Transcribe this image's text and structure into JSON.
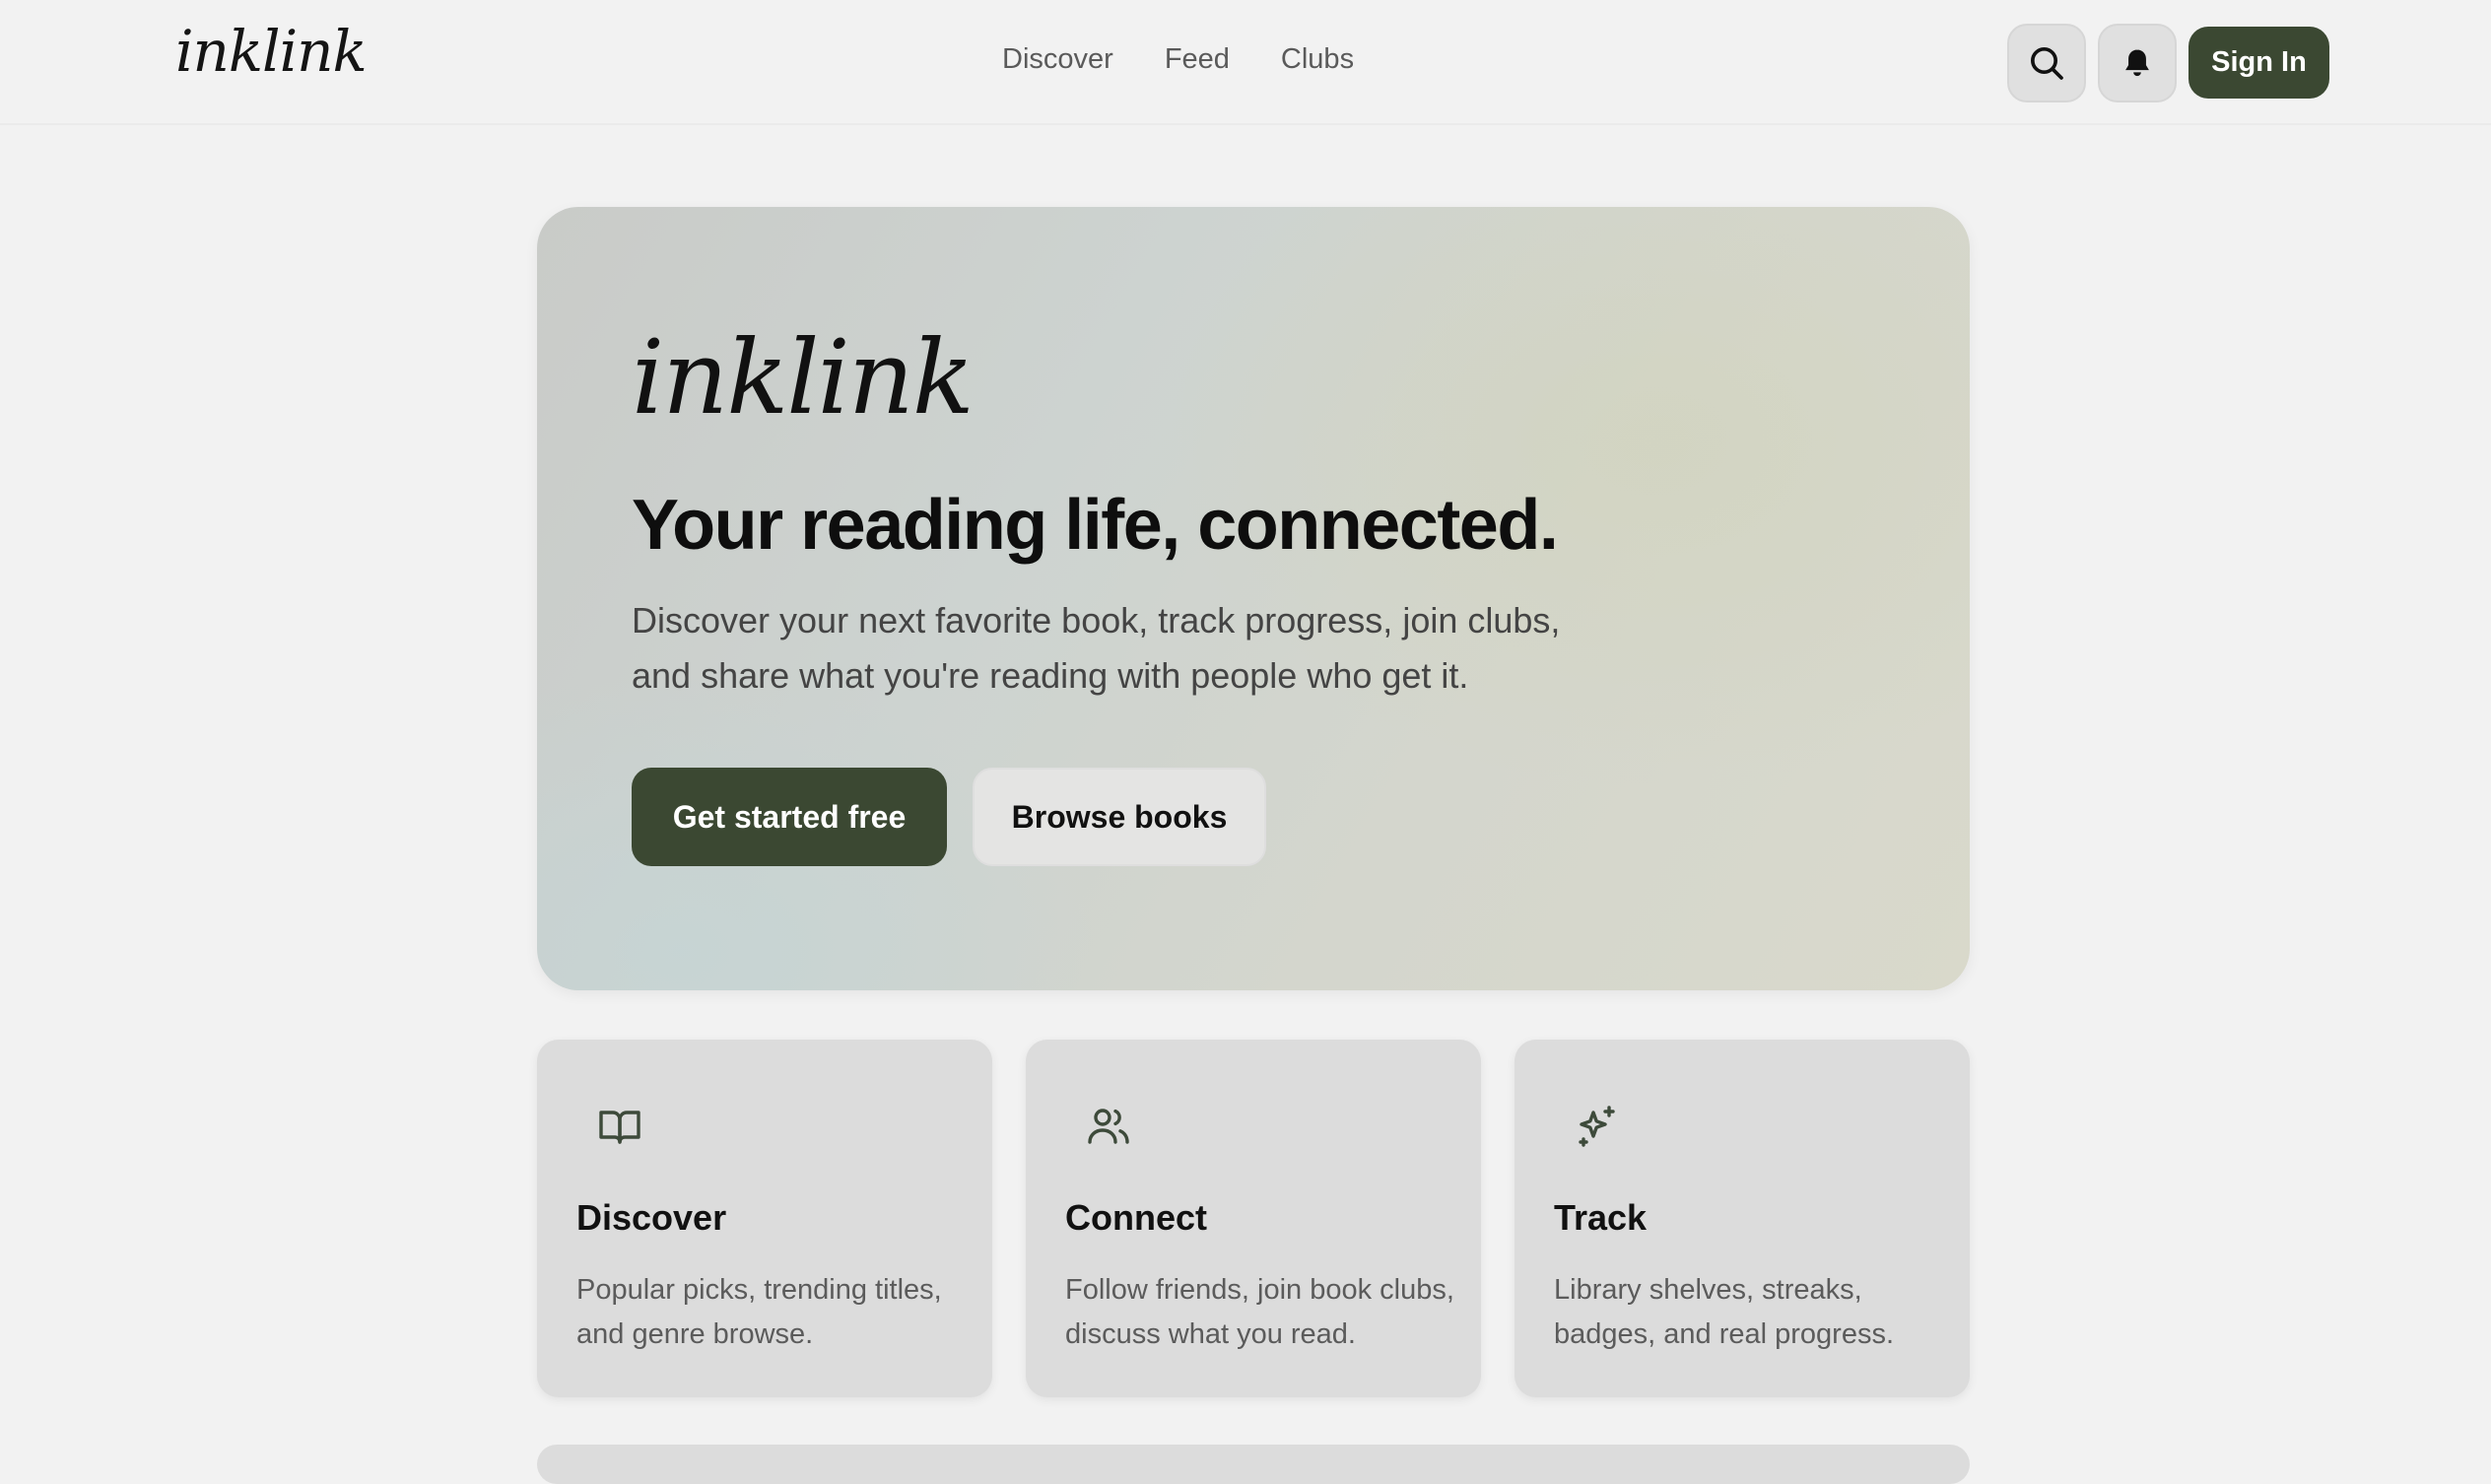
{
  "header": {
    "logo": "inklink",
    "nav": [
      "Discover",
      "Feed",
      "Clubs"
    ],
    "sign_in": "Sign In"
  },
  "hero": {
    "logo": "inklink",
    "title": "Your reading life, connected.",
    "subtitle_line1": "Discover your next favorite book, track progress, join clubs,",
    "subtitle_line2": "and share what you're reading with people who get it.",
    "primary_cta": "Get started free",
    "secondary_cta": "Browse books"
  },
  "features": [
    {
      "icon": "open-book-icon",
      "title": "Discover",
      "desc_line1": "Popular picks, trending titles,",
      "desc_line2": "and genre browse."
    },
    {
      "icon": "users-icon",
      "title": "Connect",
      "desc_line1": "Follow friends, join book clubs,",
      "desc_line2": "discuss what you read."
    },
    {
      "icon": "sparkles-icon",
      "title": "Track",
      "desc_line1": "Library shelves, streaks,",
      "desc_line2": "badges, and real progress."
    }
  ],
  "colors": {
    "accent": "#3b4832",
    "background": "#f2f2f2",
    "card": "#dcdcdc"
  }
}
